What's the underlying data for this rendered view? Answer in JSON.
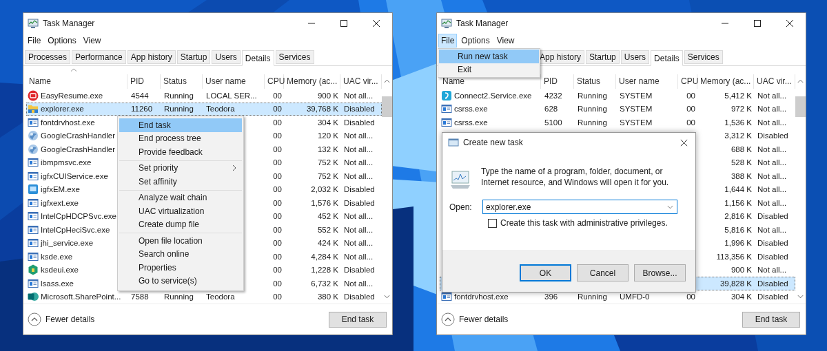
{
  "windows": [
    {
      "title": "Task Manager",
      "menu": [
        {
          "label": "File",
          "selected": false
        },
        {
          "label": "Options",
          "selected": false
        },
        {
          "label": "View",
          "selected": false
        }
      ],
      "tabs": [
        {
          "label": "Processes",
          "selected": false
        },
        {
          "label": "Performance",
          "selected": false
        },
        {
          "label": "App history",
          "selected": false
        },
        {
          "label": "Startup",
          "selected": false
        },
        {
          "label": "Users",
          "selected": false
        },
        {
          "label": "Details",
          "selected": true
        },
        {
          "label": "Services",
          "selected": false
        }
      ],
      "columns": [
        "Name",
        "PID",
        "Status",
        "User name",
        "CPU",
        "Memory (ac...",
        "UAC vir..."
      ],
      "rows": [
        {
          "kind": "resume",
          "name": "EasyResume.exe",
          "pid": "4544",
          "status": "Running",
          "user": "LOCAL SER...",
          "cpu": "00",
          "memory": "900 K",
          "uac": "Not all...",
          "selected": false
        },
        {
          "kind": "folder",
          "name": "explorer.exe",
          "pid": "11260",
          "status": "Running",
          "user": "Teodora",
          "cpu": "00",
          "memory": "39,768 K",
          "uac": "Disabled",
          "selected": true
        },
        {
          "kind": "exe",
          "name": "fontdrvhost.exe",
          "cpu": "00",
          "memory": "304 K",
          "uac": "Disabled",
          "selected": false
        },
        {
          "kind": "orb",
          "name": "GoogleCrashHandler",
          "cpu": "00",
          "memory": "120 K",
          "uac": "Not all...",
          "selected": false
        },
        {
          "kind": "orb",
          "name": "GoogleCrashHandler",
          "cpu": "00",
          "memory": "132 K",
          "uac": "Not all...",
          "selected": false
        },
        {
          "kind": "exe",
          "name": "ibmpmsvc.exe",
          "cpu": "00",
          "memory": "752 K",
          "uac": "Not all...",
          "selected": false
        },
        {
          "kind": "exe",
          "name": "igfxCUIService.exe",
          "cpu": "00",
          "memory": "752 K",
          "uac": "Not all...",
          "selected": false
        },
        {
          "kind": "screen",
          "name": "igfxEM.exe",
          "cpu": "00",
          "memory": "2,032 K",
          "uac": "Disabled",
          "selected": false
        },
        {
          "kind": "exe",
          "name": "igfxext.exe",
          "cpu": "00",
          "memory": "1,576 K",
          "uac": "Disabled",
          "selected": false
        },
        {
          "kind": "exe",
          "name": "IntelCpHDCPSvc.exe",
          "cpu": "00",
          "memory": "452 K",
          "uac": "Not all...",
          "selected": false
        },
        {
          "kind": "exe",
          "name": "IntelCpHeciSvc.exe",
          "cpu": "00",
          "memory": "552 K",
          "uac": "Not all...",
          "selected": false
        },
        {
          "kind": "exe",
          "name": "jhi_service.exe",
          "cpu": "00",
          "memory": "424 K",
          "uac": "Not all...",
          "selected": false
        },
        {
          "kind": "exe",
          "name": "ksde.exe",
          "cpu": "00",
          "memory": "4,284 K",
          "uac": "Not all...",
          "selected": false
        },
        {
          "kind": "hexagon",
          "name": "ksdeui.exe",
          "cpu": "00",
          "memory": "1,228 K",
          "uac": "Disabled",
          "selected": false
        },
        {
          "kind": "exe",
          "name": "lsass.exe",
          "cpu": "00",
          "memory": "6,732 K",
          "uac": "Not all...",
          "selected": false
        },
        {
          "kind": "teal",
          "name": "Microsoft.SharePoint...",
          "pid": "7588",
          "status": "Running",
          "user": "Teodora",
          "cpu": "00",
          "memory": "380 K",
          "uac": "Disabled",
          "selected": false
        }
      ],
      "context_menu": {
        "groups": [
          [
            {
              "label": "End task",
              "selected": true,
              "submenu": false
            },
            {
              "label": "End process tree",
              "selected": false,
              "submenu": false
            },
            {
              "label": "Provide feedback",
              "selected": false,
              "submenu": false
            }
          ],
          [
            {
              "label": "Set priority",
              "selected": false,
              "submenu": true
            },
            {
              "label": "Set affinity",
              "selected": false,
              "submenu": false
            }
          ],
          [
            {
              "label": "Analyze wait chain",
              "selected": false,
              "submenu": false
            },
            {
              "label": "UAC virtualization",
              "selected": false,
              "submenu": false
            },
            {
              "label": "Create dump file",
              "selected": false,
              "submenu": false
            }
          ],
          [
            {
              "label": "Open file location",
              "selected": false,
              "submenu": false
            },
            {
              "label": "Search online",
              "selected": false,
              "submenu": false
            },
            {
              "label": "Properties",
              "selected": false,
              "submenu": false
            },
            {
              "label": "Go to service(s)",
              "selected": false,
              "submenu": false
            }
          ]
        ]
      },
      "footer": {
        "details": "Fewer details",
        "button": "End task"
      }
    },
    {
      "title": "Task Manager",
      "menu": [
        {
          "label": "File",
          "selected": true
        },
        {
          "label": "Options",
          "selected": false
        },
        {
          "label": "View",
          "selected": false
        }
      ],
      "tabs": [
        {
          "label": "App history",
          "selected": false
        },
        {
          "label": "Startup",
          "selected": false
        },
        {
          "label": "Users",
          "selected": false
        },
        {
          "label": "Details",
          "selected": true
        },
        {
          "label": "Services",
          "selected": false
        }
      ],
      "columns": [
        "Name",
        "PID",
        "Status",
        "User name",
        "CPU",
        "Memory (ac...",
        "UAC vir..."
      ],
      "rows": [
        {
          "kind": "rounded",
          "name": "Connect2.Service.exe",
          "pid": "4232",
          "status": "Running",
          "user": "SYSTEM",
          "cpu": "00",
          "memory": "5,412 K",
          "uac": "Not all...",
          "selected": false
        },
        {
          "kind": "exe",
          "name": "csrss.exe",
          "pid": "628",
          "status": "Running",
          "user": "SYSTEM",
          "cpu": "00",
          "memory": "972 K",
          "uac": "Not all...",
          "selected": false
        },
        {
          "kind": "exe",
          "name": "csrss.exe",
          "pid": "5100",
          "status": "Running",
          "user": "SYSTEM",
          "cpu": "00",
          "memory": "1,536 K",
          "uac": "Not all...",
          "selected": false
        },
        {
          "memory": "3,312 K",
          "uac": "Disabled",
          "selected": false
        },
        {
          "memory": "688 K",
          "uac": "Not all...",
          "selected": false
        },
        {
          "memory": "528 K",
          "uac": "Not all...",
          "selected": false
        },
        {
          "memory": "388 K",
          "uac": "Not all...",
          "selected": false
        },
        {
          "memory": "1,644 K",
          "uac": "Not all...",
          "selected": false
        },
        {
          "memory": "1,156 K",
          "uac": "Not all...",
          "selected": false
        },
        {
          "memory": "2,816 K",
          "uac": "Disabled",
          "selected": false
        },
        {
          "memory": "5,816 K",
          "uac": "Not all...",
          "selected": false
        },
        {
          "memory": "1,996 K",
          "uac": "Disabled",
          "selected": false
        },
        {
          "memory": "113,356 K",
          "uac": "Disabled",
          "selected": false
        },
        {
          "memory": "900 K",
          "uac": "Not all...",
          "selected": false
        },
        {
          "memory": "39,828 K",
          "uac": "Disabled",
          "selected": true
        },
        {
          "kind": "exe",
          "name": "fontdrvhost.exe",
          "pid": "396",
          "status": "Running",
          "user": "UMFD-0",
          "cpu": "00",
          "memory": "304 K",
          "uac": "Disabled",
          "selected": false
        }
      ],
      "file_menu": [
        {
          "label": "Run new task",
          "selected": true
        },
        {
          "label": "Exit",
          "selected": false
        }
      ],
      "dialog": {
        "title": "Create new task",
        "description": "Type the name of a program, folder, document, or Internet resource, and Windows will open it for you.",
        "open_label": "Open:",
        "value": "explorer.exe",
        "checkbox": {
          "label": "Create this task with administrative privileges.",
          "checked": false
        },
        "buttons": [
          {
            "label": "OK",
            "default": true
          },
          {
            "label": "Cancel",
            "default": false
          },
          {
            "label": "Browse...",
            "default": false
          }
        ]
      },
      "footer": {
        "details": "Fewer details",
        "button": "End task"
      }
    }
  ]
}
